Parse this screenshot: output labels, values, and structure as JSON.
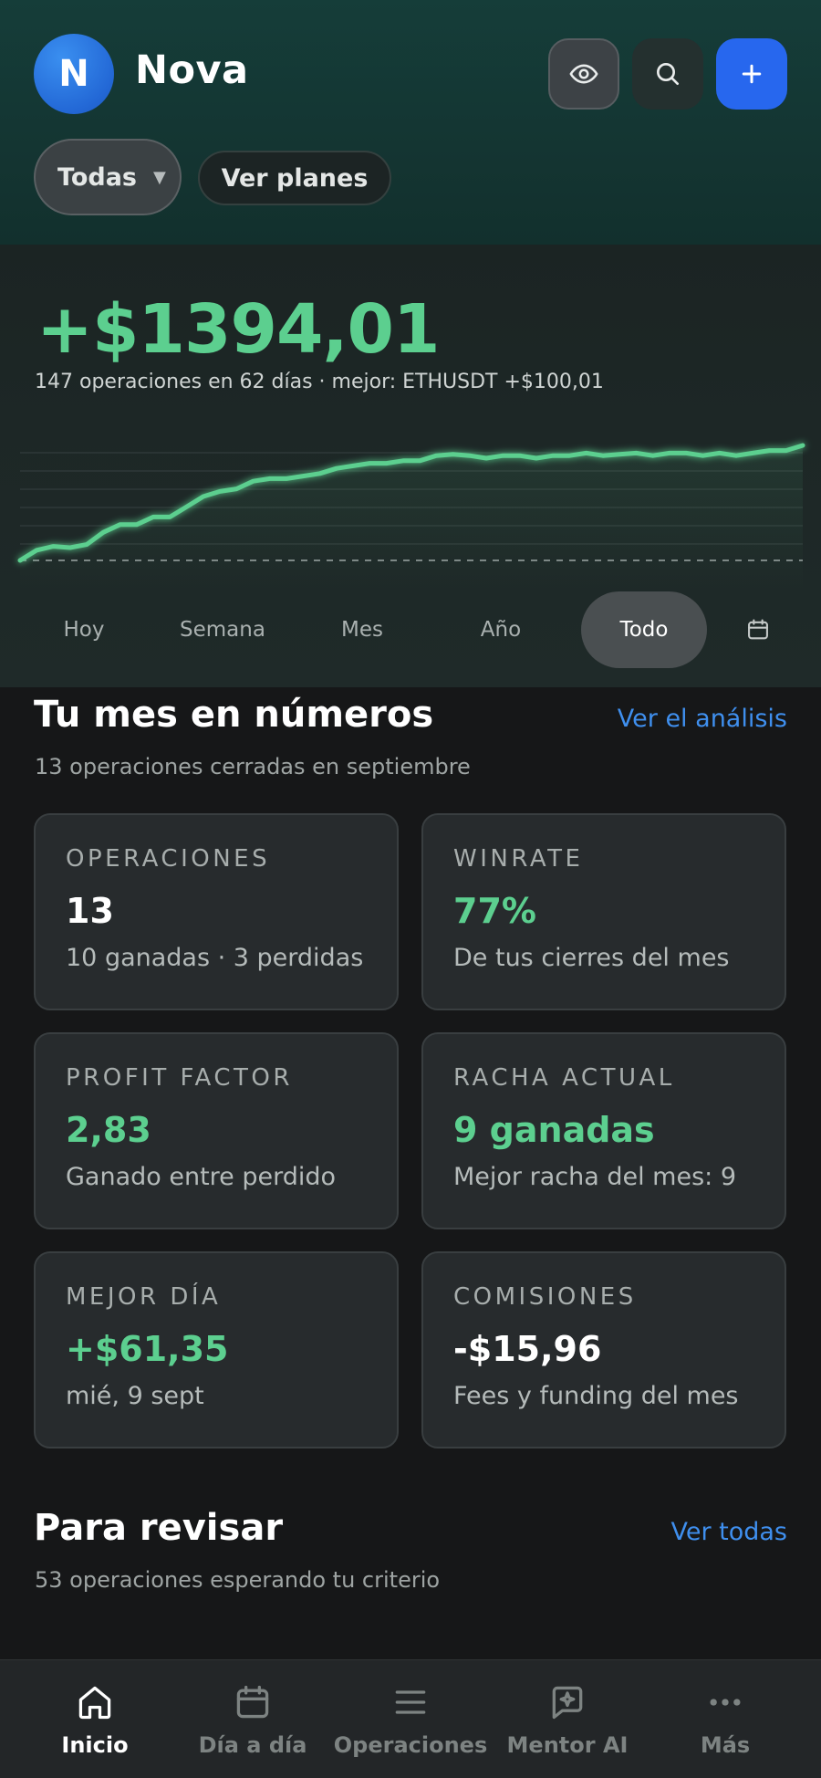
{
  "header": {
    "avatar_letter": "N",
    "app_name": "Nova",
    "filter_label": "Todas",
    "plans_label": "Ver planes",
    "icons": [
      "eye-icon",
      "search-icon",
      "plus-icon"
    ],
    "accent_color": "#2767ee"
  },
  "hero": {
    "total_pnl": "+$1394,01",
    "summary": "147 operaciones en 62 días · mejor: ETHUSDT +$100,01",
    "positive_color": "#5ccf8f",
    "ranges": [
      "Hoy",
      "Semana",
      "Mes",
      "Año",
      "Todo"
    ],
    "active_range": "Todo",
    "calendar_icon": "calendar-icon"
  },
  "chart_data": {
    "type": "line",
    "title": "",
    "xlabel": "",
    "ylabel": "",
    "grid": true,
    "baseline_dashed": true,
    "series": [
      {
        "values": [
          0,
          40,
          55,
          50,
          62,
          110,
          140,
          140,
          170,
          170,
          210,
          250,
          270,
          280,
          310,
          320,
          320,
          330,
          340,
          360,
          370,
          380,
          380,
          390,
          390,
          410,
          415,
          410,
          400,
          410,
          410,
          400,
          410,
          410,
          420,
          410,
          415,
          420,
          410,
          420,
          420,
          410,
          420,
          410,
          420,
          430,
          430,
          450
        ]
      }
    ]
  },
  "month": {
    "title": "Tu mes en números",
    "link": "Ver el análisis",
    "subtitle": "13 operaciones cerradas en septiembre",
    "cards": [
      {
        "label": "OPERACIONES",
        "value": "13",
        "desc": "10 ganadas · 3 perdidas"
      },
      {
        "label": "WINRATE",
        "value": "77%",
        "desc": "De tus cierres del mes"
      },
      {
        "label": "PROFIT FACTOR",
        "value": "2,83",
        "desc": "Ganado entre perdido"
      },
      {
        "label": "RACHA ACTUAL",
        "value": "9 ganadas",
        "desc": "Mejor racha del mes: 9"
      },
      {
        "label": "MEJOR DÍA",
        "value": "+$61,35",
        "desc": "mié, 9 sept"
      },
      {
        "label": "COMISIONES",
        "value": "-$15,96",
        "desc": "Fees y funding del mes"
      }
    ]
  },
  "review": {
    "title": "Para revisar",
    "link": "Ver todas",
    "subtitle": "53 operaciones esperando tu criterio"
  },
  "nav": {
    "items": [
      {
        "label": "Inicio",
        "icon": "home-icon"
      },
      {
        "label": "Día a día",
        "icon": "calendar-icon"
      },
      {
        "label": "Operaciones",
        "icon": "list-icon"
      },
      {
        "label": "Mentor AI",
        "icon": "chat-sparkle-icon"
      },
      {
        "label": "Más",
        "icon": "more-icon"
      }
    ],
    "active_index": 0
  }
}
